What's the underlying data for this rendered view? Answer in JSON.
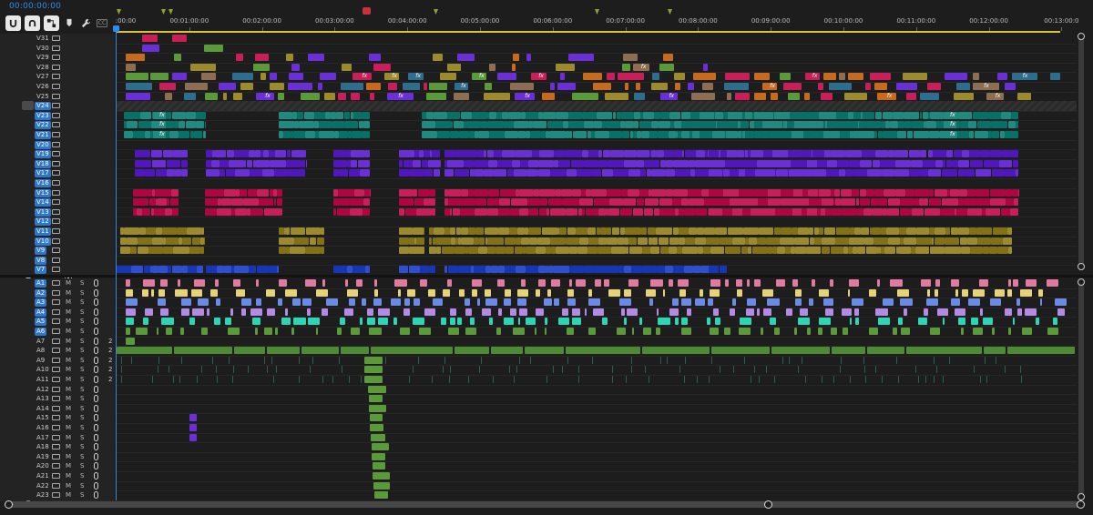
{
  "timecode": "00:00:00:00",
  "toolbar": {
    "buttons": [
      {
        "name": "snap-button",
        "icon": "snap-icon",
        "on": true
      },
      {
        "name": "linked-selection-button",
        "icon": "linked-selection-icon",
        "on": true
      },
      {
        "name": "insert-sequence-button",
        "icon": "sequence-nest-icon",
        "on": true
      },
      {
        "name": "add-marker-button",
        "icon": "marker-icon",
        "on": false
      },
      {
        "name": "timeline-settings-button",
        "icon": "wrench-icon",
        "on": false
      },
      {
        "name": "captions-button",
        "icon": "cc-icon",
        "on": false
      }
    ],
    "captions_label": "CC"
  },
  "ruler": {
    "labels": [
      ":00:00",
      "00:01:00:00",
      "00:02:00:00",
      "00:03:00:00",
      "00:04:00:00",
      "00:05:00:00",
      "00:06:00:00",
      "00:07:00:00",
      "00:08:00:00",
      "00:09:00:00",
      "00:10:00:00",
      "00:11:00:00",
      "00:12:00:00",
      "00:13:00:0"
    ]
  },
  "video_tracks": [
    {
      "name": "V31",
      "active": false
    },
    {
      "name": "V30",
      "active": false
    },
    {
      "name": "V29",
      "active": false
    },
    {
      "name": "V28",
      "active": false
    },
    {
      "name": "V27",
      "active": false
    },
    {
      "name": "V26",
      "active": false
    },
    {
      "name": "V25",
      "active": false
    },
    {
      "name": "V24",
      "active": true,
      "locked": true
    },
    {
      "name": "V23",
      "active": true
    },
    {
      "name": "V22",
      "active": true
    },
    {
      "name": "V21",
      "active": true
    },
    {
      "name": "V20",
      "active": true
    },
    {
      "name": "V19",
      "active": true
    },
    {
      "name": "V18",
      "active": true
    },
    {
      "name": "V17",
      "active": true
    },
    {
      "name": "V16",
      "active": true
    },
    {
      "name": "V15",
      "active": true
    },
    {
      "name": "V14",
      "active": true
    },
    {
      "name": "V13",
      "active": true
    },
    {
      "name": "V12",
      "active": true
    },
    {
      "name": "V11",
      "active": true
    },
    {
      "name": "V10",
      "active": true
    },
    {
      "name": "V9",
      "active": true
    },
    {
      "name": "V8",
      "active": true
    },
    {
      "name": "V7",
      "active": true
    }
  ],
  "audio_tracks": [
    {
      "name": "A1",
      "active": true,
      "m": "M",
      "s": "S",
      "chan": ""
    },
    {
      "name": "A2",
      "active": true,
      "m": "M",
      "s": "S",
      "chan": ""
    },
    {
      "name": "A3",
      "active": true,
      "m": "M",
      "s": "S",
      "chan": ""
    },
    {
      "name": "A4",
      "active": true,
      "m": "M",
      "s": "S",
      "chan": ""
    },
    {
      "name": "A5",
      "active": true,
      "m": "M",
      "s": "S",
      "chan": ""
    },
    {
      "name": "A6",
      "active": true,
      "m": "M",
      "s": "S",
      "chan": ""
    },
    {
      "name": "A7",
      "active": false,
      "m": "M",
      "s": "S",
      "chan": "2"
    },
    {
      "name": "A8",
      "active": false,
      "m": "M",
      "s": "S",
      "chan": "2"
    },
    {
      "name": "A9",
      "active": false,
      "m": "M",
      "s": "S",
      "chan": "2"
    },
    {
      "name": "A10",
      "active": false,
      "m": "M",
      "s": "S",
      "chan": "2"
    },
    {
      "name": "A11",
      "active": false,
      "m": "M",
      "s": "S",
      "chan": "2"
    },
    {
      "name": "A12",
      "active": false,
      "m": "M",
      "s": "S",
      "chan": ""
    },
    {
      "name": "A13",
      "active": false,
      "m": "M",
      "s": "S",
      "chan": ""
    },
    {
      "name": "A14",
      "active": false,
      "m": "M",
      "s": "S",
      "chan": ""
    },
    {
      "name": "A15",
      "active": false,
      "m": "M",
      "s": "S",
      "chan": ""
    },
    {
      "name": "A16",
      "active": false,
      "m": "M",
      "s": "S",
      "chan": ""
    },
    {
      "name": "A17",
      "active": false,
      "m": "M",
      "s": "S",
      "chan": ""
    },
    {
      "name": "A18",
      "active": false,
      "m": "M",
      "s": "S",
      "chan": ""
    },
    {
      "name": "A19",
      "active": false,
      "m": "M",
      "s": "S",
      "chan": ""
    },
    {
      "name": "A20",
      "active": false,
      "m": "M",
      "s": "S",
      "chan": ""
    },
    {
      "name": "A21",
      "active": false,
      "m": "M",
      "s": "S",
      "chan": ""
    },
    {
      "name": "A22",
      "active": false,
      "m": "M",
      "s": "S",
      "chan": ""
    },
    {
      "name": "A23",
      "active": false,
      "m": "M",
      "s": "S",
      "chan": ""
    }
  ],
  "fx_badge": "fx",
  "colors": {
    "accent": "#2d8ceb",
    "teal": "#1f8a80",
    "violet": "#6a2fd6",
    "crimson": "#c81e5a",
    "olive": "#9b8a2e",
    "royal": "#2f4fd0",
    "green": "#5a9a3a",
    "orange": "#c86a1e",
    "pink": "#e07aa0",
    "yellow": "#e6d27a",
    "lightblue": "#6b8ae6",
    "lavender": "#b48ae6",
    "aqua": "#2ad6b4"
  }
}
